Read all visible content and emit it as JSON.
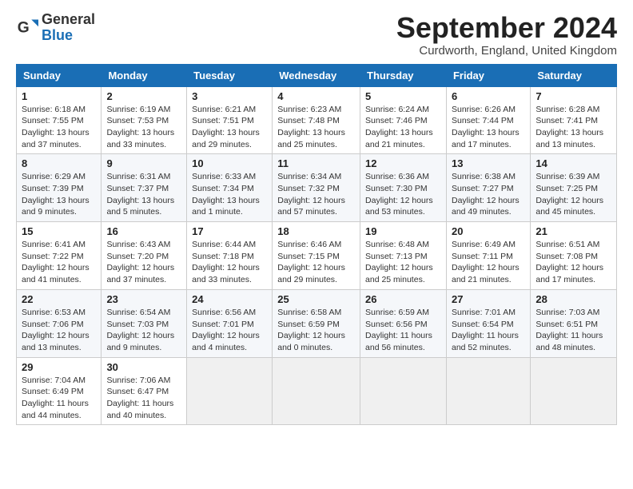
{
  "logo": {
    "general": "General",
    "blue": "Blue"
  },
  "header": {
    "month": "September 2024",
    "location": "Curdworth, England, United Kingdom"
  },
  "days_header": [
    "Sunday",
    "Monday",
    "Tuesday",
    "Wednesday",
    "Thursday",
    "Friday",
    "Saturday"
  ],
  "weeks": [
    [
      {
        "day": "1",
        "sunrise": "6:18 AM",
        "sunset": "7:55 PM",
        "daylight": "13 hours and 37 minutes."
      },
      {
        "day": "2",
        "sunrise": "6:19 AM",
        "sunset": "7:53 PM",
        "daylight": "13 hours and 33 minutes."
      },
      {
        "day": "3",
        "sunrise": "6:21 AM",
        "sunset": "7:51 PM",
        "daylight": "13 hours and 29 minutes."
      },
      {
        "day": "4",
        "sunrise": "6:23 AM",
        "sunset": "7:48 PM",
        "daylight": "13 hours and 25 minutes."
      },
      {
        "day": "5",
        "sunrise": "6:24 AM",
        "sunset": "7:46 PM",
        "daylight": "13 hours and 21 minutes."
      },
      {
        "day": "6",
        "sunrise": "6:26 AM",
        "sunset": "7:44 PM",
        "daylight": "13 hours and 17 minutes."
      },
      {
        "day": "7",
        "sunrise": "6:28 AM",
        "sunset": "7:41 PM",
        "daylight": "13 hours and 13 minutes."
      }
    ],
    [
      {
        "day": "8",
        "sunrise": "6:29 AM",
        "sunset": "7:39 PM",
        "daylight": "13 hours and 9 minutes."
      },
      {
        "day": "9",
        "sunrise": "6:31 AM",
        "sunset": "7:37 PM",
        "daylight": "13 hours and 5 minutes."
      },
      {
        "day": "10",
        "sunrise": "6:33 AM",
        "sunset": "7:34 PM",
        "daylight": "13 hours and 1 minute."
      },
      {
        "day": "11",
        "sunrise": "6:34 AM",
        "sunset": "7:32 PM",
        "daylight": "12 hours and 57 minutes."
      },
      {
        "day": "12",
        "sunrise": "6:36 AM",
        "sunset": "7:30 PM",
        "daylight": "12 hours and 53 minutes."
      },
      {
        "day": "13",
        "sunrise": "6:38 AM",
        "sunset": "7:27 PM",
        "daylight": "12 hours and 49 minutes."
      },
      {
        "day": "14",
        "sunrise": "6:39 AM",
        "sunset": "7:25 PM",
        "daylight": "12 hours and 45 minutes."
      }
    ],
    [
      {
        "day": "15",
        "sunrise": "6:41 AM",
        "sunset": "7:22 PM",
        "daylight": "12 hours and 41 minutes."
      },
      {
        "day": "16",
        "sunrise": "6:43 AM",
        "sunset": "7:20 PM",
        "daylight": "12 hours and 37 minutes."
      },
      {
        "day": "17",
        "sunrise": "6:44 AM",
        "sunset": "7:18 PM",
        "daylight": "12 hours and 33 minutes."
      },
      {
        "day": "18",
        "sunrise": "6:46 AM",
        "sunset": "7:15 PM",
        "daylight": "12 hours and 29 minutes."
      },
      {
        "day": "19",
        "sunrise": "6:48 AM",
        "sunset": "7:13 PM",
        "daylight": "12 hours and 25 minutes."
      },
      {
        "day": "20",
        "sunrise": "6:49 AM",
        "sunset": "7:11 PM",
        "daylight": "12 hours and 21 minutes."
      },
      {
        "day": "21",
        "sunrise": "6:51 AM",
        "sunset": "7:08 PM",
        "daylight": "12 hours and 17 minutes."
      }
    ],
    [
      {
        "day": "22",
        "sunrise": "6:53 AM",
        "sunset": "7:06 PM",
        "daylight": "12 hours and 13 minutes."
      },
      {
        "day": "23",
        "sunrise": "6:54 AM",
        "sunset": "7:03 PM",
        "daylight": "12 hours and 9 minutes."
      },
      {
        "day": "24",
        "sunrise": "6:56 AM",
        "sunset": "7:01 PM",
        "daylight": "12 hours and 4 minutes."
      },
      {
        "day": "25",
        "sunrise": "6:58 AM",
        "sunset": "6:59 PM",
        "daylight": "12 hours and 0 minutes."
      },
      {
        "day": "26",
        "sunrise": "6:59 AM",
        "sunset": "6:56 PM",
        "daylight": "11 hours and 56 minutes."
      },
      {
        "day": "27",
        "sunrise": "7:01 AM",
        "sunset": "6:54 PM",
        "daylight": "11 hours and 52 minutes."
      },
      {
        "day": "28",
        "sunrise": "7:03 AM",
        "sunset": "6:51 PM",
        "daylight": "11 hours and 48 minutes."
      }
    ],
    [
      {
        "day": "29",
        "sunrise": "7:04 AM",
        "sunset": "6:49 PM",
        "daylight": "11 hours and 44 minutes."
      },
      {
        "day": "30",
        "sunrise": "7:06 AM",
        "sunset": "6:47 PM",
        "daylight": "11 hours and 40 minutes."
      },
      null,
      null,
      null,
      null,
      null
    ]
  ]
}
